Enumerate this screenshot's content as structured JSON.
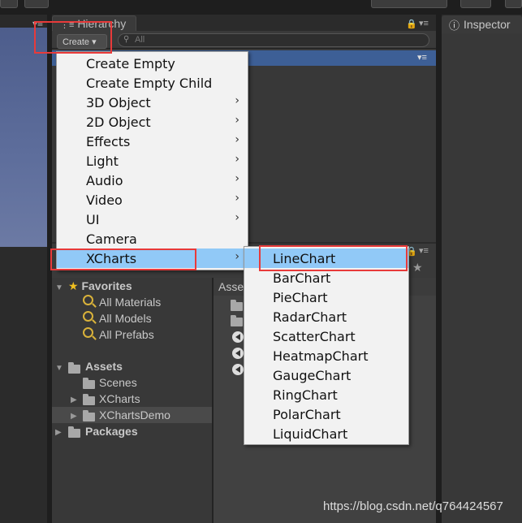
{
  "hierarchy": {
    "tab_label": "Hierarchy",
    "create_button": "Create ▾",
    "search_placeholder": "All"
  },
  "inspector": {
    "tab_label": "Inspector",
    "icon": "info-icon"
  },
  "create_menu": {
    "items": [
      {
        "label": "Create Empty",
        "submenu": false
      },
      {
        "label": "Create Empty Child",
        "submenu": false
      },
      {
        "label": "3D Object",
        "submenu": true
      },
      {
        "label": "2D Object",
        "submenu": true
      },
      {
        "label": "Effects",
        "submenu": true
      },
      {
        "label": "Light",
        "submenu": true
      },
      {
        "label": "Audio",
        "submenu": true
      },
      {
        "label": "Video",
        "submenu": true
      },
      {
        "label": "UI",
        "submenu": true
      },
      {
        "label": "Camera",
        "submenu": false
      },
      {
        "label": "XCharts",
        "submenu": true,
        "highlighted": true
      }
    ],
    "arrow_glyph": "›"
  },
  "xcharts_submenu": {
    "items": [
      {
        "label": "LineChart",
        "highlighted": true
      },
      {
        "label": "BarChart"
      },
      {
        "label": "PieChart"
      },
      {
        "label": "RadarChart"
      },
      {
        "label": "ScatterChart"
      },
      {
        "label": "HeatmapChart"
      },
      {
        "label": "GaugeChart"
      },
      {
        "label": "RingChart"
      },
      {
        "label": "PolarChart"
      },
      {
        "label": "LiquidChart"
      }
    ]
  },
  "project": {
    "assets_breadcrumb": "Asse",
    "tree": {
      "favorites": "Favorites",
      "all_materials": "All Materials",
      "all_models": "All Models",
      "all_prefabs": "All Prefabs",
      "assets": "Assets",
      "scenes": "Scenes",
      "xcharts": "XCharts",
      "xcharts_demo": "XChartsDemo",
      "packages": "Packages"
    }
  },
  "watermark": "https://blog.csdn.net/q764424567",
  "colors": {
    "menu_highlight": "#91c9f7",
    "annotation_red": "#e83a3a",
    "selected_row": "#3d5f96"
  }
}
